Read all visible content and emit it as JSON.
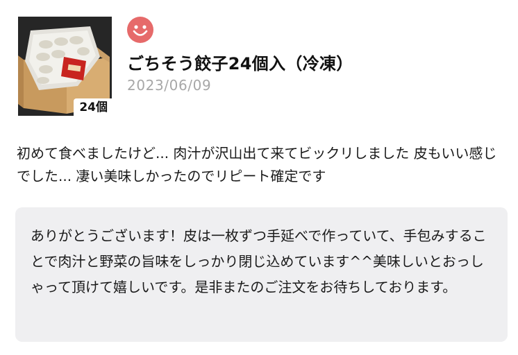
{
  "product": {
    "name": "ごちそう餃子24個入（冷凍）",
    "quantity_badge": "24個",
    "image_icon": "product-photo-dumpling-box"
  },
  "reviewer": {
    "avatar_icon": "smiley-face-icon",
    "avatar_color": "#e66a6a"
  },
  "review": {
    "date": "2023/06/09",
    "text": "初めて食べましたけど... 肉汁が沢山出て来てビックリしました 皮もいい感じでした... 凄い美味しかったのでリピート確定です"
  },
  "reply": {
    "text": "ありがとうございます！皮は一枚ずつ手延べで作っていて、手包みすることで肉汁と野菜の旨味をしっかり閉じ込めています^^美味しいとおっしゃって頂けて嬉しいです。是非またのご注文をお待ちしております。",
    "background": "#efeff1"
  }
}
